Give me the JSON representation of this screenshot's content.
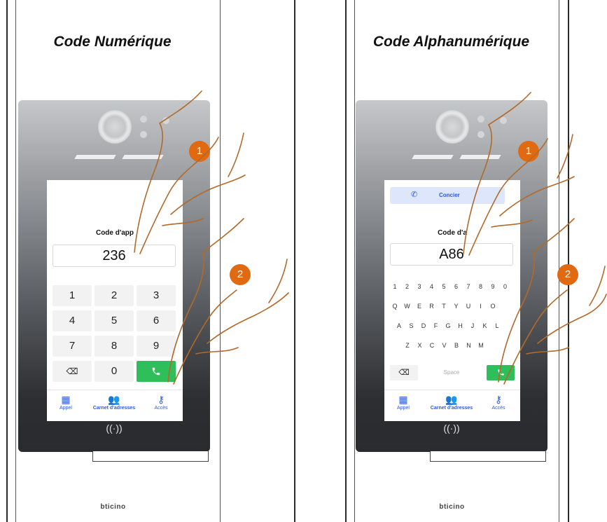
{
  "left": {
    "title": "Code Numérique",
    "code_label": "Code d'app",
    "code_value": "236",
    "keypad": [
      "1",
      "2",
      "3",
      "4",
      "5",
      "6",
      "7",
      "8",
      "9",
      "⌫",
      "0",
      "call"
    ],
    "steps": [
      "1",
      "2"
    ]
  },
  "right": {
    "title": "Code Alphanumérique",
    "concierge_label": "Concier",
    "code_label": "Code d'a",
    "code_value": "A86",
    "rows": [
      [
        "1",
        "2",
        "3",
        "4",
        "5",
        "6",
        "7",
        "8",
        "9",
        "0"
      ],
      [
        "Q",
        "W",
        "E",
        "R",
        "T",
        "Y",
        "U",
        "I",
        "O"
      ],
      [
        "A",
        "S",
        "D",
        "F",
        "G",
        "H",
        "J",
        "K",
        "L"
      ],
      [
        "Z",
        "X",
        "C",
        "V",
        "B",
        "N",
        "M"
      ]
    ],
    "space_label": "Space",
    "steps": [
      "1",
      "2"
    ]
  },
  "nav": {
    "call": "Appel",
    "directory": "Carnet d'adresses",
    "access": "Accès"
  },
  "nfc_symbol": "((·))",
  "brand": "bticino",
  "colors": {
    "accent_orange": "#e06a12",
    "call_green": "#2fbf5a",
    "nav_blue": "#2e5bd8"
  }
}
